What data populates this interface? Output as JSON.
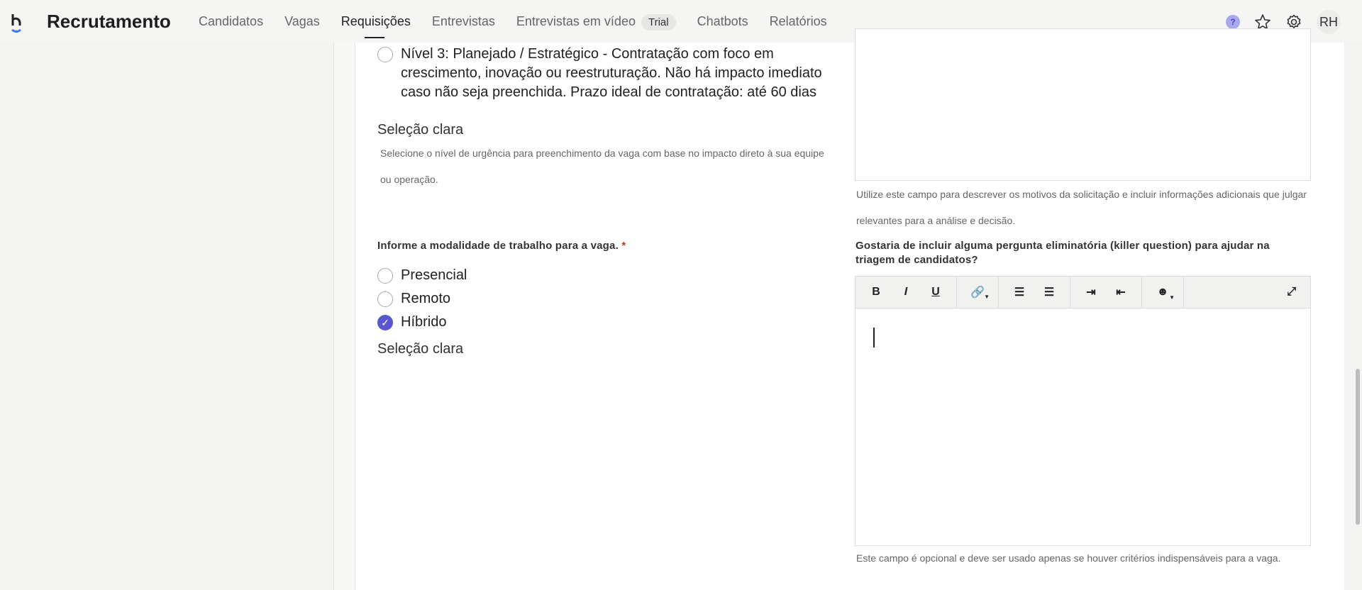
{
  "nav": {
    "brand": "Recrutamento",
    "items": [
      "Candidatos",
      "Vagas",
      "Requisições",
      "Entrevistas",
      "Entrevistas em vídeo",
      "Chatbots",
      "Relatórios"
    ],
    "trial": "Trial",
    "help": "?",
    "avatar": "RH"
  },
  "urgency": {
    "option3": "Nível 3: Planejado / Estratégico - Contratação com foco em crescimento, inovação ou reestruturação. Não há impacto imediato caso não seja preenchida. Prazo ideal de contratação: até 60 dias",
    "clear": "Seleção clara",
    "help": "Selecione o nível de urgência para preenchimento da vaga com base no impacto direto à sua equipe ou operação."
  },
  "reason": {
    "help": "Utilize este campo para descrever os motivos da solicitação e incluir informações adicionais que julgar relevantes para a análise e decisão."
  },
  "modality": {
    "label": "Informe a modalidade de trabalho para a vaga.",
    "required": "*",
    "options": [
      {
        "label": "Presencial",
        "checked": false
      },
      {
        "label": "Remoto",
        "checked": false
      },
      {
        "label": "Híbrido",
        "checked": true
      }
    ],
    "clear": "Seleção clara"
  },
  "killer": {
    "label": "Gostaria de incluir alguma pergunta eliminatória (killer question) para ajudar na triagem de candidatos?",
    "help": "Este campo é opcional e deve ser usado apenas se houver critérios indispensáveis para a vaga.",
    "toolbar": {
      "bold": "B",
      "italic": "I",
      "underline": "U"
    }
  }
}
